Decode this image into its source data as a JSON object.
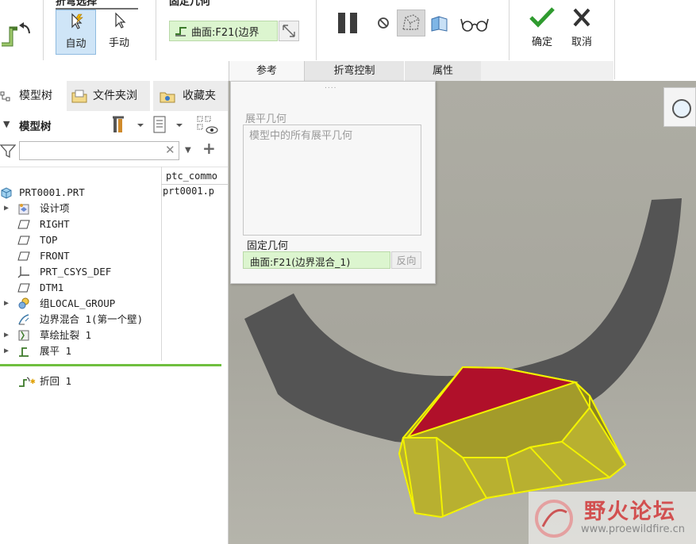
{
  "ribbon": {
    "group1_title": "折弯选择",
    "group2_title": "固定几何",
    "auto_label": "自动",
    "manual_label": "手动",
    "fixed_geom_value": "曲面:F21(边界",
    "ok_label": "确定",
    "cancel_label": "取消",
    "tabs": [
      "参考",
      "折弯控制",
      "属性"
    ]
  },
  "navigator": {
    "tabs": [
      "模型树",
      "文件夹浏",
      "收藏夹"
    ],
    "tree_title": "模型树",
    "search_placeholder": "",
    "column_header": "ptc_commo",
    "column_value": "prt0001.p",
    "items": [
      {
        "label": "PRT0001.PRT",
        "icon": "part-icon"
      },
      {
        "label": "设计项",
        "icon": "design-items-icon"
      },
      {
        "label": "RIGHT",
        "icon": "datum-plane-icon"
      },
      {
        "label": "TOP",
        "icon": "datum-plane-icon"
      },
      {
        "label": "FRONT",
        "icon": "datum-plane-icon"
      },
      {
        "label": "PRT_CSYS_DEF",
        "icon": "csys-icon"
      },
      {
        "label": "DTM1",
        "icon": "datum-plane-icon"
      },
      {
        "label": "组LOCAL_GROUP",
        "icon": "group-icon"
      },
      {
        "label": "边界混合 1(第一个壁)",
        "icon": "boundary-blend-icon"
      },
      {
        "label": "草绘扯裂 1",
        "icon": "sketch-rip-icon"
      },
      {
        "label": "展平 1",
        "icon": "unbend-icon"
      },
      {
        "label": "折回 1",
        "icon": "bend-back-icon"
      }
    ]
  },
  "ref_panel": {
    "unbend_geom_title": "展平几何",
    "unbend_geom_value": "模型中的所有展平几何",
    "fixed_geom_title": "固定几何",
    "fixed_geom_value": "曲面:F21(边界混合_1)",
    "flip_label": "反向"
  },
  "watermark": {
    "title": "野火论坛",
    "url": "www.proewildfire.cn"
  },
  "colors": {
    "accent_blue": "#1a6fc4",
    "check_green": "#2f9b2f",
    "highlight_red": "#b0102a",
    "highlight_yellow": "#f2f200",
    "part_gray": "#545454"
  }
}
